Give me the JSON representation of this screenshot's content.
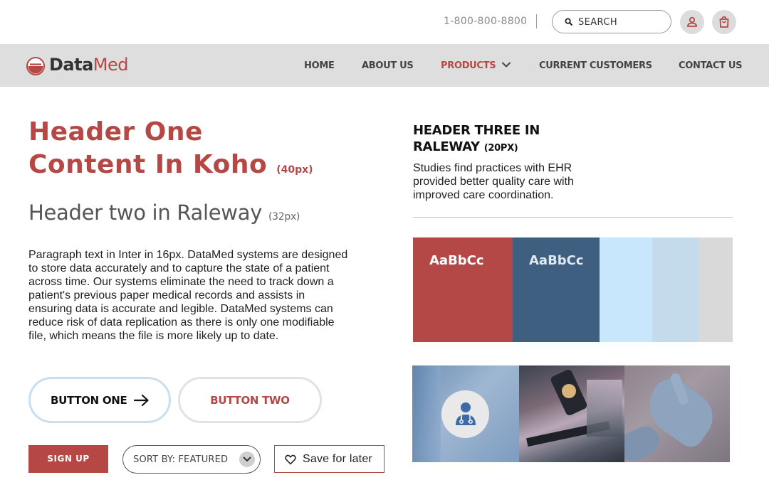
{
  "topbar": {
    "phone": "1-800-800-8800",
    "search_placeholder": "SEARCH",
    "account_icon": "person-icon",
    "cart_icon": "shopping-bag-icon"
  },
  "nav": {
    "logo_data": "Data",
    "logo_med": "Med",
    "items": [
      {
        "label": "HOME"
      },
      {
        "label": "ABOUT US"
      },
      {
        "label": "PRODUCTS",
        "active": true
      },
      {
        "label": "CURRENT CUSTOMERS"
      },
      {
        "label": "CONTACT US"
      }
    ]
  },
  "left": {
    "h1_line1": "Header One",
    "h1_line2": "Content In Koho",
    "h1_size": "(40px)",
    "h2_text": "Header two in Raleway",
    "h2_size": "(32px)",
    "paragraph": "Paragraph text in Inter in 16px. DataMed systems are designed to store data accurately and to capture the state of a patient across time. Our systems eliminate the need to track down a patient's previous paper medical records and assists in ensuring data is accurate and legible. DataMed systems can reduce risk of data replication as there is only one modifiable file, which means the file is more likely up to date.",
    "button_one": "BUTTON ONE",
    "button_two": "BUTTON TWO",
    "sign_up": "SIGN UP",
    "sort_label": "SORT BY: FEATURED",
    "save_label": "Save for later"
  },
  "right": {
    "h3_text": "HEADER THREE IN RALEWAY",
    "h3_size": "(20PX)",
    "h3_body": "Studies find practices with EHR provided better quality care with improved care coordination.",
    "swatches": [
      {
        "color": "#b34846",
        "label": "AaBbCc",
        "text_color": "#ffffff"
      },
      {
        "color": "#3f5f80",
        "label": "AaBbCc",
        "text_color": "#dfe9f3"
      },
      {
        "color": "#c8e7fd",
        "label": ""
      },
      {
        "color": "#c4dbeb",
        "label": ""
      },
      {
        "color": "#d9d9d9",
        "label": ""
      }
    ]
  },
  "colors": {
    "brand_red": "#b54845",
    "brand_blue": "#3f5f80",
    "nav_bg": "#dedede"
  }
}
